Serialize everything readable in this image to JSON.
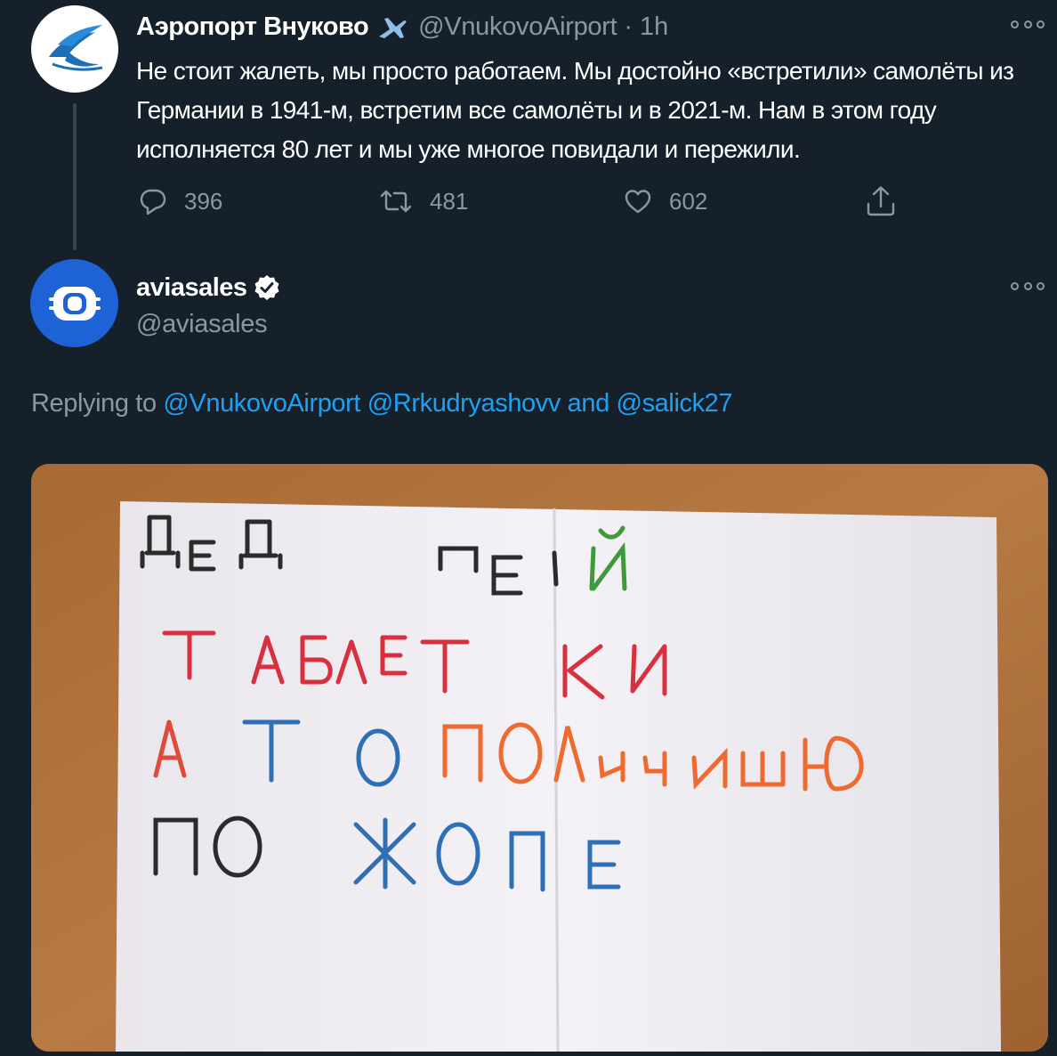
{
  "tweet1": {
    "name": "Аэропорт Внуково",
    "handle": "@VnukovoAirport",
    "separator": "·",
    "time": "1h",
    "text": "Не стоит жалеть, мы просто работаем. Мы достойно «встретили» самолёты из Германии в 1941-м, встретим все самолёты и в 2021-м. Нам в этом году исполняется 80 лет и мы уже многое повидали и пережили.",
    "stats": {
      "replies": "396",
      "retweets": "481",
      "likes": "602"
    },
    "icons": [
      "plane-icon",
      "reply-icon",
      "retweet-icon",
      "like-icon",
      "share-icon",
      "more-icon"
    ]
  },
  "tweet2": {
    "name": "aviasales",
    "handle": "@aviasales",
    "replying_label": "Replying to",
    "mentions": [
      "@VnukovoAirport",
      "@Rrkudryashovv"
    ],
    "and_label": "and",
    "last_mention": "@salick27",
    "icons": [
      "verified-icon",
      "more-icon"
    ]
  },
  "media": {
    "lines": [
      {
        "text": "ДЕД ПЕЙ",
        "color": "#2b2b2b"
      },
      {
        "text": "ТАБЛЕТКИ",
        "color": "#d9303f"
      },
      {
        "text": "А ТО ПОЛУЧИШЬ",
        "color": "#e65a2a"
      },
      {
        "text": "ПО ЖОПЕ",
        "color": "#2f6fb5"
      }
    ]
  },
  "colors": {
    "background": "#15202b",
    "secondary_text": "#8899a6",
    "link": "#1da1f2",
    "aviasales_blue": "#1e63d6"
  }
}
